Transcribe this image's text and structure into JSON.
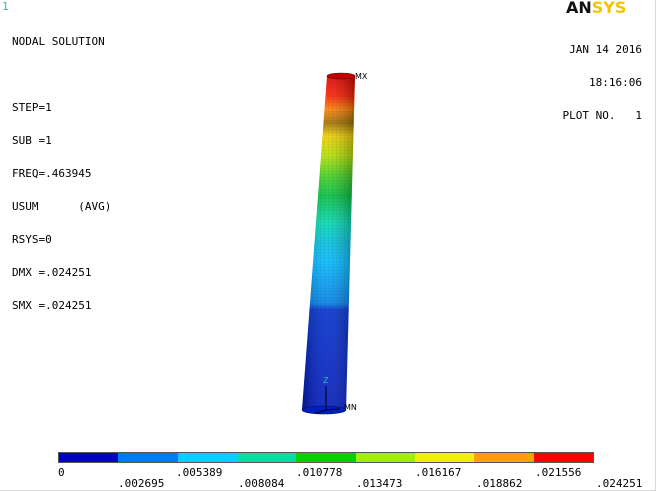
{
  "window_number": "1",
  "logo": {
    "an": "AN",
    "sys": "SYS"
  },
  "header": {
    "date": "JAN 14 2016",
    "time": "18:16:06",
    "plot": "PLOT NO.   1"
  },
  "info_lines": [
    "NODAL SOLUTION",
    "",
    "STEP=1",
    "SUB =1",
    "FREQ=.463945",
    "USUM      (AVG)",
    "RSYS=0",
    "DMX =.024251",
    "SMX =.024251"
  ],
  "markers": {
    "mx": "MX",
    "mn": "MN",
    "axis_z": "Z"
  },
  "legend": {
    "colors": [
      "#0000c8",
      "#0078ff",
      "#00d2ff",
      "#00e0a0",
      "#00d200",
      "#a0f000",
      "#f0f000",
      "#ffa000",
      "#ff0000"
    ],
    "upper_labels": [
      "0",
      ".005389",
      ".010778",
      ".016167",
      ".021556"
    ],
    "lower_labels": [
      ".002695",
      ".008084",
      ".013473",
      ".018862",
      ".024251"
    ]
  }
}
